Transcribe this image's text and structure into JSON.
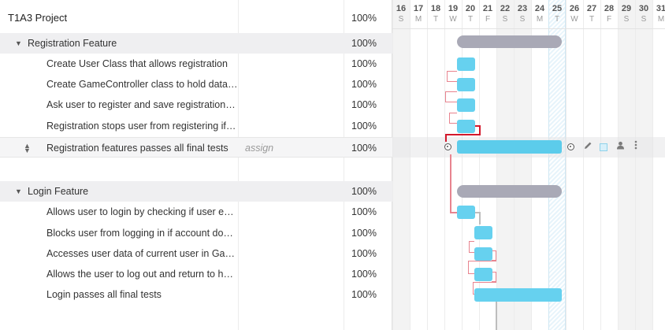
{
  "project": {
    "name": "T1A3 Project",
    "percent": "100%"
  },
  "rows": [
    {
      "name": "Registration Feature",
      "percent": "100%"
    },
    {
      "name": "Create User Class that allows registration",
      "percent": "100%"
    },
    {
      "name": "Create GameController class to hold data…",
      "percent": "100%"
    },
    {
      "name": "Ask user to register and save registration…",
      "percent": "100%"
    },
    {
      "name": "Registration stops user from registering if…",
      "percent": "100%"
    },
    {
      "name": "Registration features passes all final tests",
      "percent": "100%",
      "assign": "assign"
    },
    {
      "name": "Login Feature",
      "percent": "100%"
    },
    {
      "name": "Allows user to login by checking if user e…",
      "percent": "100%"
    },
    {
      "name": "Blocks user from logging in if account do…",
      "percent": "100%"
    },
    {
      "name": "Accesses user data of current user in Ga…",
      "percent": "100%"
    },
    {
      "name": "Allows the user to log out and return to h…",
      "percent": "100%"
    },
    {
      "name": "Login passes all final tests",
      "percent": "100%"
    }
  ],
  "timeline": {
    "days": [
      {
        "num": "16",
        "wd": "S"
      },
      {
        "num": "17",
        "wd": "M"
      },
      {
        "num": "18",
        "wd": "T"
      },
      {
        "num": "19",
        "wd": "W"
      },
      {
        "num": "20",
        "wd": "T"
      },
      {
        "num": "21",
        "wd": "F"
      },
      {
        "num": "22",
        "wd": "S"
      },
      {
        "num": "23",
        "wd": "S"
      },
      {
        "num": "24",
        "wd": "M"
      },
      {
        "num": "25",
        "wd": "T"
      },
      {
        "num": "26",
        "wd": "W"
      },
      {
        "num": "27",
        "wd": "T"
      },
      {
        "num": "28",
        "wd": "F"
      },
      {
        "num": "29",
        "wd": "S"
      },
      {
        "num": "30",
        "wd": "S"
      },
      {
        "num": "31",
        "wd": "M"
      }
    ],
    "today": "25"
  },
  "icons": {
    "toggle": "triangle-down-icon",
    "drag": "drag-handle-icon",
    "tools": [
      "edit-icon",
      "color-icon",
      "user-icon",
      "more-icon"
    ]
  },
  "colors": {
    "task": "#66d1ef",
    "summary": "#a9a9b6",
    "dependency": "#e8848f",
    "critical": "#d3182b"
  }
}
